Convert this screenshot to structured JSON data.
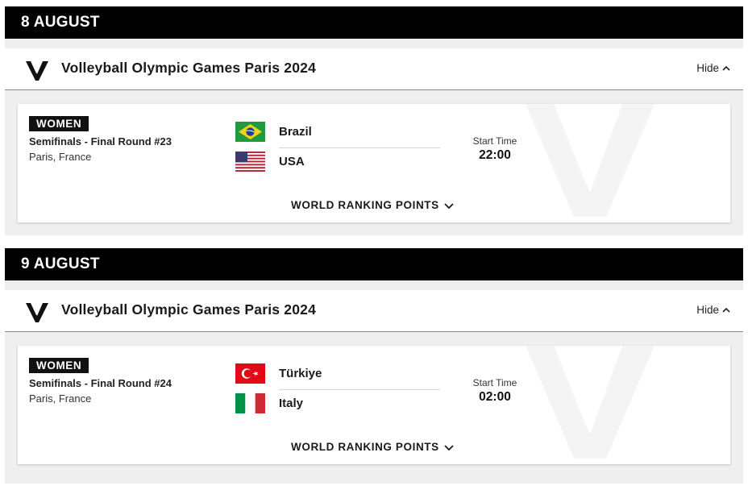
{
  "days": [
    {
      "date": "8 AUGUST",
      "competition": {
        "title": "Volleyball Olympic Games Paris 2024",
        "hide_label": "Hide"
      },
      "match": {
        "category": "WOMEN",
        "round": "Semifinals - Final Round #23",
        "venue": "Paris, France",
        "team1": {
          "name": "Brazil",
          "flag": "brazil-flag"
        },
        "team2": {
          "name": "USA",
          "flag": "usa-flag"
        },
        "start_label": "Start Time",
        "start_time": "22:00",
        "ranking_label": "WORLD RANKING POINTS"
      }
    },
    {
      "date": "9 AUGUST",
      "competition": {
        "title": "Volleyball Olympic Games Paris 2024",
        "hide_label": "Hide"
      },
      "match": {
        "category": "WOMEN",
        "round": "Semifinals - Final Round #24",
        "venue": "Paris, France",
        "team1": {
          "name": "Türkiye",
          "flag": "turkiye-flag"
        },
        "team2": {
          "name": "Italy",
          "flag": "italy-flag"
        },
        "start_label": "Start Time",
        "start_time": "02:00",
        "ranking_label": "WORLD RANKING POINTS"
      }
    }
  ],
  "colors": {
    "date_bar": "#000000",
    "section_bg": "#efefef",
    "card_bg": "#ffffff",
    "badge_bg": "#111111"
  },
  "icons": [
    "vw-logo-icon",
    "chevron-up-icon",
    "chevron-down-icon"
  ]
}
